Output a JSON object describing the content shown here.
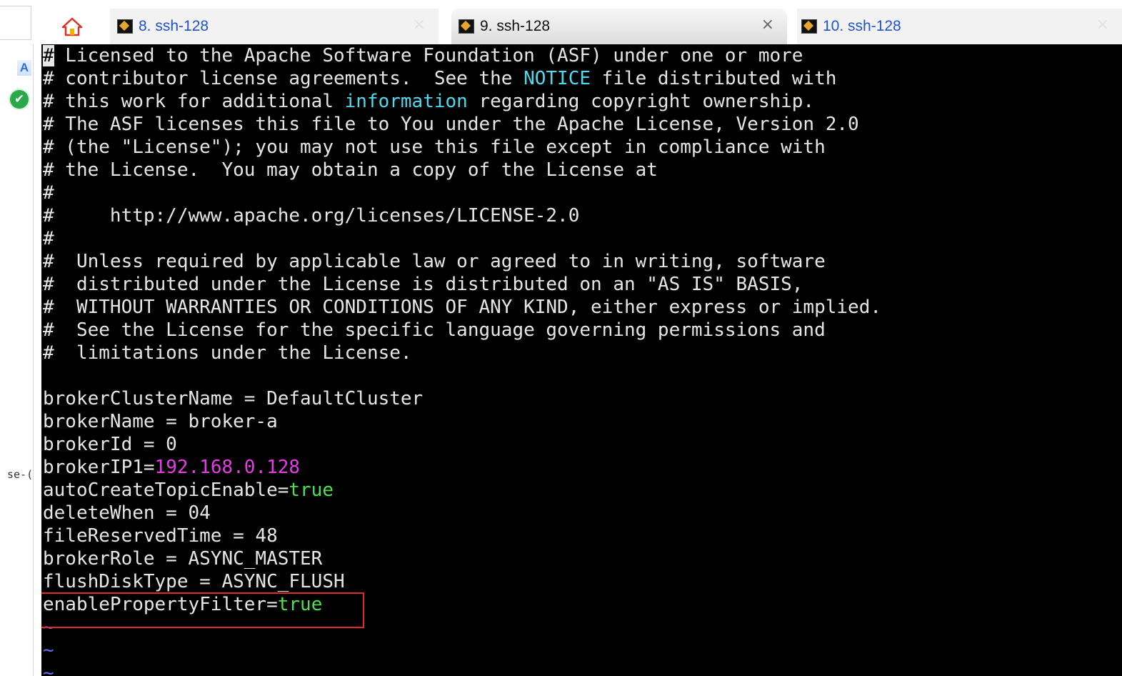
{
  "tabs": [
    {
      "label": "8. ssh-128",
      "active": false
    },
    {
      "label": "9. ssh-128",
      "active": true
    },
    {
      "label": "10. ssh-128",
      "active": false
    }
  ],
  "tab_close_glyph": "×",
  "sidebar": {
    "font_icon_glyph": "A",
    "check_icon_glyph": "✔",
    "truncated_text": "se-("
  },
  "colors": {
    "terminal_bg": "#000000",
    "text": "#e6e6e6",
    "cyan": "#4fd9ec",
    "magenta": "#e53de3",
    "green": "#4fe04f",
    "tilde": "#6d6df0",
    "highlight_border": "#e0282f"
  },
  "terminal": {
    "lines": [
      {
        "parts": [
          {
            "t": "#",
            "c": "cursor"
          },
          {
            "t": " Licensed to the Apache Software Foundation (ASF) under one or more"
          }
        ]
      },
      {
        "parts": [
          {
            "t": "# contributor license agreements.  See the "
          },
          {
            "t": "NOTICE",
            "c": "kw-cyan"
          },
          {
            "t": " file distributed with"
          }
        ]
      },
      {
        "parts": [
          {
            "t": "# this work for additional "
          },
          {
            "t": "information",
            "c": "kw-cyan"
          },
          {
            "t": " regarding copyright ownership."
          }
        ]
      },
      {
        "parts": [
          {
            "t": "# The ASF licenses this file to You under the Apache License, Version 2.0"
          }
        ]
      },
      {
        "parts": [
          {
            "t": "# (the \"License\"); you may not use this file except in compliance with"
          }
        ]
      },
      {
        "parts": [
          {
            "t": "# the License.  You may obtain a copy of the License at"
          }
        ]
      },
      {
        "parts": [
          {
            "t": "#"
          }
        ]
      },
      {
        "parts": [
          {
            "t": "#     http://www.apache.org/licenses/LICENSE-2.0"
          }
        ]
      },
      {
        "parts": [
          {
            "t": "#"
          }
        ]
      },
      {
        "parts": [
          {
            "t": "#  Unless required by applicable law or agreed to in writing, software"
          }
        ]
      },
      {
        "parts": [
          {
            "t": "#  distributed under the License is distributed on an \"AS IS\" BASIS,"
          }
        ]
      },
      {
        "parts": [
          {
            "t": "#  WITHOUT WARRANTIES OR CONDITIONS OF ANY KIND, either express or implied."
          }
        ]
      },
      {
        "parts": [
          {
            "t": "#  See the License for the specific language governing permissions and"
          }
        ]
      },
      {
        "parts": [
          {
            "t": "#  limitations under the License."
          }
        ]
      },
      {
        "parts": [
          {
            "t": ""
          }
        ]
      },
      {
        "parts": [
          {
            "t": "brokerClusterName = DefaultCluster"
          }
        ]
      },
      {
        "parts": [
          {
            "t": "brokerName = broker-a"
          }
        ]
      },
      {
        "parts": [
          {
            "t": "brokerId = 0"
          }
        ]
      },
      {
        "parts": [
          {
            "t": "brokerIP1="
          },
          {
            "t": "192.168.0.128",
            "c": "kw-magenta"
          }
        ]
      },
      {
        "parts": [
          {
            "t": "autoCreateTopicEnable="
          },
          {
            "t": "true",
            "c": "kw-green"
          }
        ]
      },
      {
        "parts": [
          {
            "t": "deleteWhen = 04"
          }
        ]
      },
      {
        "parts": [
          {
            "t": "fileReservedTime = 48"
          }
        ]
      },
      {
        "parts": [
          {
            "t": "brokerRole = ASYNC_MASTER"
          }
        ]
      },
      {
        "parts": [
          {
            "t": "flushDiskType = ASYNC_FLUSH"
          }
        ]
      },
      {
        "parts": [
          {
            "t": "enablePropertyFilter="
          },
          {
            "t": "true",
            "c": "kw-green"
          }
        ]
      },
      {
        "parts": [
          {
            "t": "~",
            "c": "tilde"
          }
        ]
      },
      {
        "parts": [
          {
            "t": "~",
            "c": "tilde"
          }
        ]
      },
      {
        "parts": [
          {
            "t": "~",
            "c": "tilde"
          }
        ]
      }
    ]
  }
}
